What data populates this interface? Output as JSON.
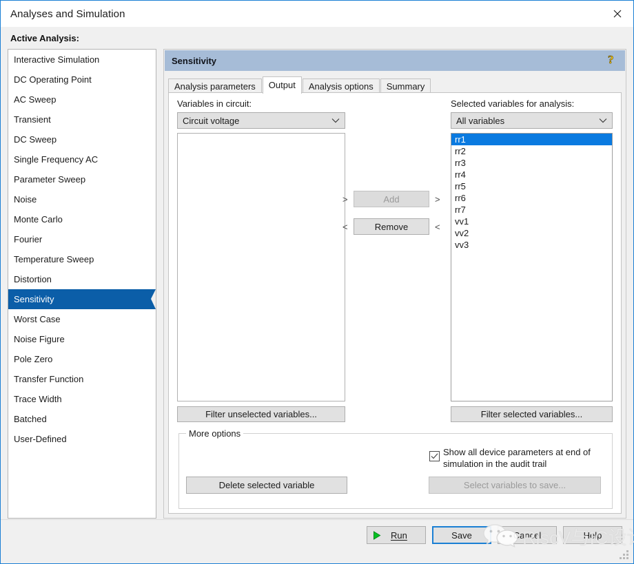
{
  "window": {
    "title": "Analyses and Simulation",
    "close_icon": "close-icon"
  },
  "sidebar": {
    "label": "Active Analysis:",
    "items": [
      {
        "label": "Interactive Simulation",
        "selected": false
      },
      {
        "label": "DC Operating Point",
        "selected": false
      },
      {
        "label": "AC Sweep",
        "selected": false
      },
      {
        "label": "Transient",
        "selected": false
      },
      {
        "label": "DC Sweep",
        "selected": false
      },
      {
        "label": "Single Frequency AC",
        "selected": false
      },
      {
        "label": "Parameter Sweep",
        "selected": false
      },
      {
        "label": "Noise",
        "selected": false
      },
      {
        "label": "Monte Carlo",
        "selected": false
      },
      {
        "label": "Fourier",
        "selected": false
      },
      {
        "label": "Temperature Sweep",
        "selected": false
      },
      {
        "label": "Distortion",
        "selected": false
      },
      {
        "label": "Sensitivity",
        "selected": true
      },
      {
        "label": "Worst Case",
        "selected": false
      },
      {
        "label": "Noise Figure",
        "selected": false
      },
      {
        "label": "Pole Zero",
        "selected": false
      },
      {
        "label": "Transfer Function",
        "selected": false
      },
      {
        "label": "Trace Width",
        "selected": false
      },
      {
        "label": "Batched",
        "selected": false
      },
      {
        "label": "User-Defined",
        "selected": false
      }
    ]
  },
  "panel": {
    "title": "Sensitivity",
    "help_icon": "question-mark-help-icon",
    "tabs": [
      {
        "label": "Analysis parameters",
        "active": false
      },
      {
        "label": "Output",
        "active": true
      },
      {
        "label": "Analysis options",
        "active": false
      },
      {
        "label": "Summary",
        "active": false
      }
    ]
  },
  "output_tab": {
    "left": {
      "label": "Variables in circuit:",
      "combo_value": "Circuit voltage",
      "combo_chevron": "chevron-down-icon",
      "list_items": [],
      "filter_button": "Filter unselected variables..."
    },
    "right": {
      "label": "Selected variables for analysis:",
      "combo_value": "All variables",
      "combo_chevron": "chevron-down-icon",
      "list_items": [
        {
          "label": "rr1",
          "selected": true
        },
        {
          "label": "rr2",
          "selected": false
        },
        {
          "label": "rr3",
          "selected": false
        },
        {
          "label": "rr4",
          "selected": false
        },
        {
          "label": "rr5",
          "selected": false
        },
        {
          "label": "rr6",
          "selected": false
        },
        {
          "label": "rr7",
          "selected": false
        },
        {
          "label": "vv1",
          "selected": false
        },
        {
          "label": "vv2",
          "selected": false
        },
        {
          "label": "vv3",
          "selected": false
        }
      ],
      "filter_button": "Filter selected variables..."
    },
    "transfer": {
      "add_label": "Add",
      "remove_label": "Remove",
      "add_left_arrow": ">",
      "add_right_arrow": ">",
      "remove_left_arrow": "<",
      "remove_right_arrow": "<"
    },
    "more_options": {
      "legend": "More options",
      "delete_button": "Delete selected variable",
      "checkbox_label": "Show all device parameters at end of simulation in the audit trail",
      "checkbox_checked": true,
      "select_vars_button": "Select variables to save..."
    }
  },
  "footer": {
    "run_label": "Run",
    "run_icon": "play-triangle-icon",
    "save_label": "Save",
    "cancel_label": "Cancel",
    "help_label": "Help"
  },
  "watermark": {
    "text": "RiscV与IC设计",
    "icon": "wechat-logo-icon"
  },
  "colors": {
    "accent_blue": "#1a7fd4",
    "selection_blue": "#0b5ea8",
    "list_selection_blue": "#0a7ae0",
    "panel_header": "#a6bcd7",
    "help_yellow": "#ffd11a",
    "run_green": "#00b020"
  }
}
